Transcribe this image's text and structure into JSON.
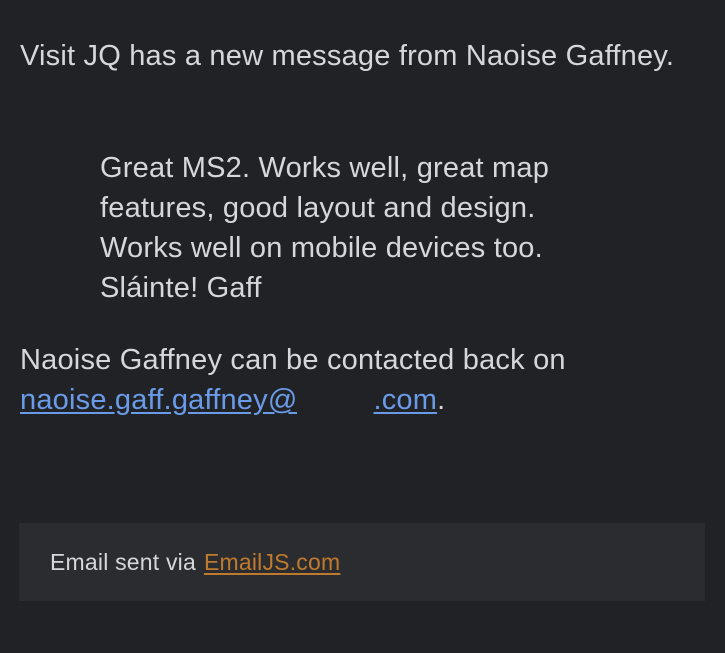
{
  "message": {
    "intro": "Visit JQ has a new message from Naoise Gaffney.",
    "quote_lines": [
      "Great MS2. Works well, great map",
      "features, good layout and design.",
      "Works well on mobile devices too.",
      "Sláinte! Gaff"
    ],
    "contact_prefix": "Naoise Gaffney can be contacted back on",
    "email_visible_start": "naoise.gaff.gaffney@",
    "email_visible_end": ".com",
    "contact_suffix": "."
  },
  "footer": {
    "prefix": "Email sent via",
    "link_label": "EmailJS.com"
  },
  "colors": {
    "background": "#212226",
    "footer_background": "#2b2c30",
    "text": "#d7d7d9",
    "email_link": "#6a9be8",
    "footer_link": "#c07a2e"
  }
}
